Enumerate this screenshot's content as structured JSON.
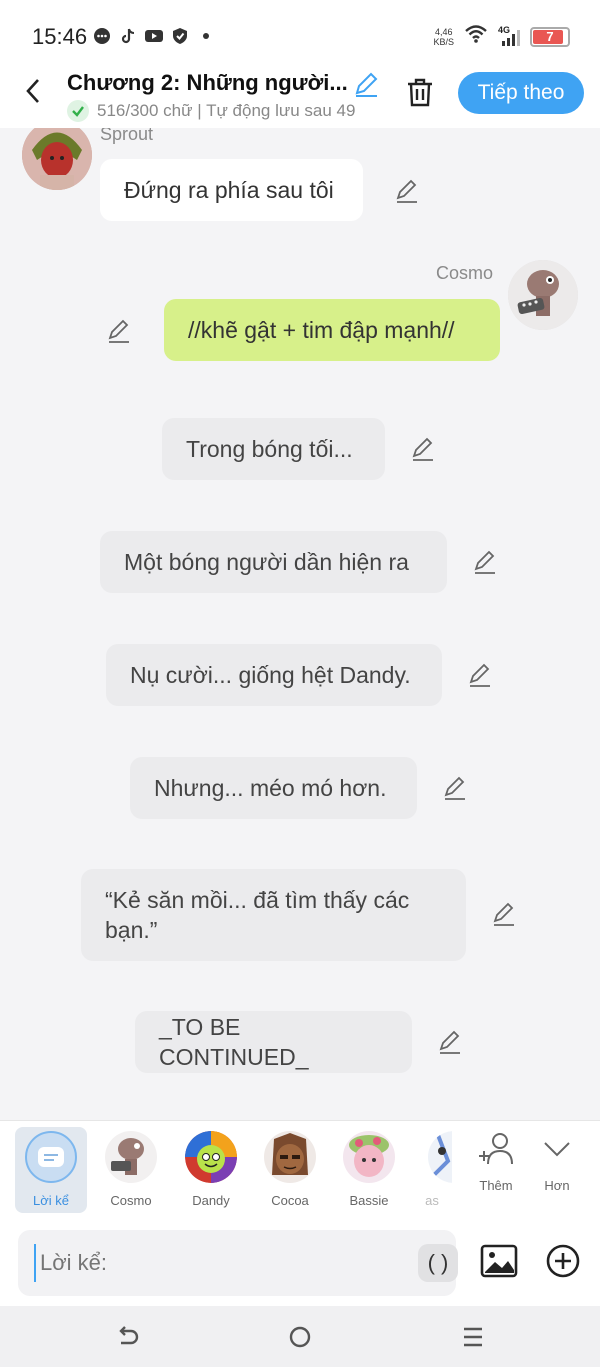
{
  "status": {
    "time": "15:46",
    "speed_top": "4,46",
    "speed_unit": "KB/S",
    "network": "4G",
    "battery": "7"
  },
  "header": {
    "title": "Chương 2: Những người...",
    "subtitle": "516/300 chữ | Tự động lưu sau 49",
    "next_label": "Tiếp theo"
  },
  "messages": [
    {
      "speaker": "Sprout",
      "text": "Đứng ra phía sau tôi"
    },
    {
      "speaker": "Cosmo",
      "text": "//khẽ gật + tim đập mạnh//"
    },
    {
      "text": "Trong bóng tối..."
    },
    {
      "text": "Một bóng người dần hiện ra"
    },
    {
      "text": "Nụ cười... giống hệt Dandy."
    },
    {
      "text": "Nhưng... méo mó hơn."
    },
    {
      "text": "“Kẻ săn mồi... đã tìm thấy các bạn.”"
    },
    {
      "text": "_TO BE CONTINUED_"
    }
  ],
  "characters": [
    {
      "name": "Lời kể"
    },
    {
      "name": "Cosmo"
    },
    {
      "name": "Dandy"
    },
    {
      "name": "Cocoa"
    },
    {
      "name": "Bassie"
    },
    {
      "name": "as"
    }
  ],
  "tools": {
    "add": "Thêm",
    "more": "Hơn"
  },
  "input": {
    "placeholder": "Lời kể:",
    "paren": "( )"
  },
  "colors": {
    "accent": "#3fa3f3",
    "green_bubble": "#d7f08a",
    "battery": "#e53935"
  }
}
